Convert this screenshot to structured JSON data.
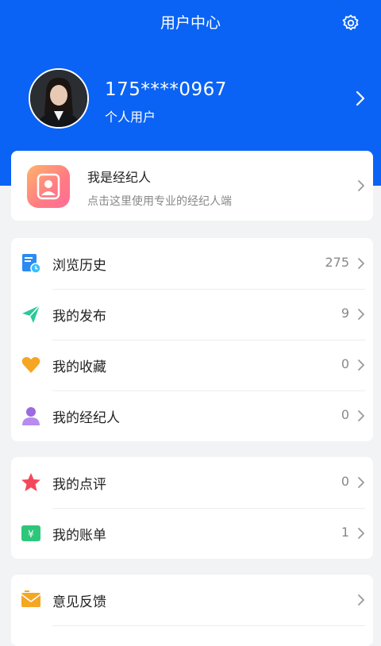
{
  "header": {
    "title": "用户中心"
  },
  "profile": {
    "phone": "175****0967",
    "user_type": "个人用户"
  },
  "agent_card": {
    "title": "我是经纪人",
    "subtitle": "点击这里使用专业的经纪人端"
  },
  "group1": [
    {
      "label": "浏览历史",
      "count": "275",
      "icon": "history-icon"
    },
    {
      "label": "我的发布",
      "count": "9",
      "icon": "paper-plane-icon"
    },
    {
      "label": "我的收藏",
      "count": "0",
      "icon": "heart-icon"
    },
    {
      "label": "我的经纪人",
      "count": "0",
      "icon": "person-icon"
    }
  ],
  "group2": [
    {
      "label": "我的点评",
      "count": "0",
      "icon": "star-icon"
    },
    {
      "label": "我的账单",
      "count": "1",
      "icon": "bill-icon"
    }
  ],
  "group3": [
    {
      "label": "意见反馈",
      "icon": "feedback-icon"
    }
  ],
  "colors": {
    "brand_blue": "#0a63f5",
    "background": "#f2f3f5"
  }
}
